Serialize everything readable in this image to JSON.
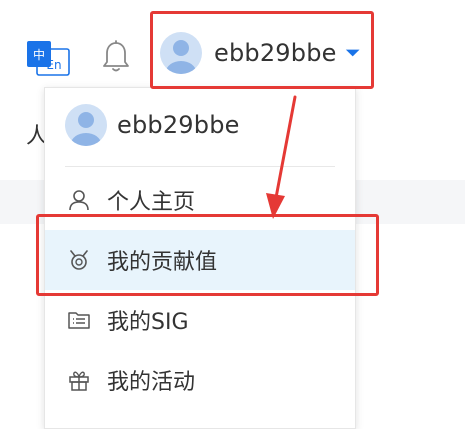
{
  "header": {
    "username": "ebb29bbe",
    "language_icon": "language-switch-icon",
    "bell_icon": "bell-icon",
    "caret_icon": "caret-down-icon"
  },
  "background": {
    "partial_text": "人"
  },
  "dropdown": {
    "username": "ebb29bbe",
    "items": [
      {
        "label": "个人主页",
        "icon": "user-icon",
        "active": false
      },
      {
        "label": "我的贡献值",
        "icon": "contribution-icon",
        "active": true
      },
      {
        "label": "我的SIG",
        "icon": "sig-list-icon",
        "active": false
      },
      {
        "label": "我的活动",
        "icon": "gift-icon",
        "active": false
      }
    ]
  },
  "colors": {
    "accent": "#1a73e8",
    "active_bg": "#e8f4fc",
    "annotation": "#e53935",
    "avatar_bg": "#cfe0f5"
  }
}
